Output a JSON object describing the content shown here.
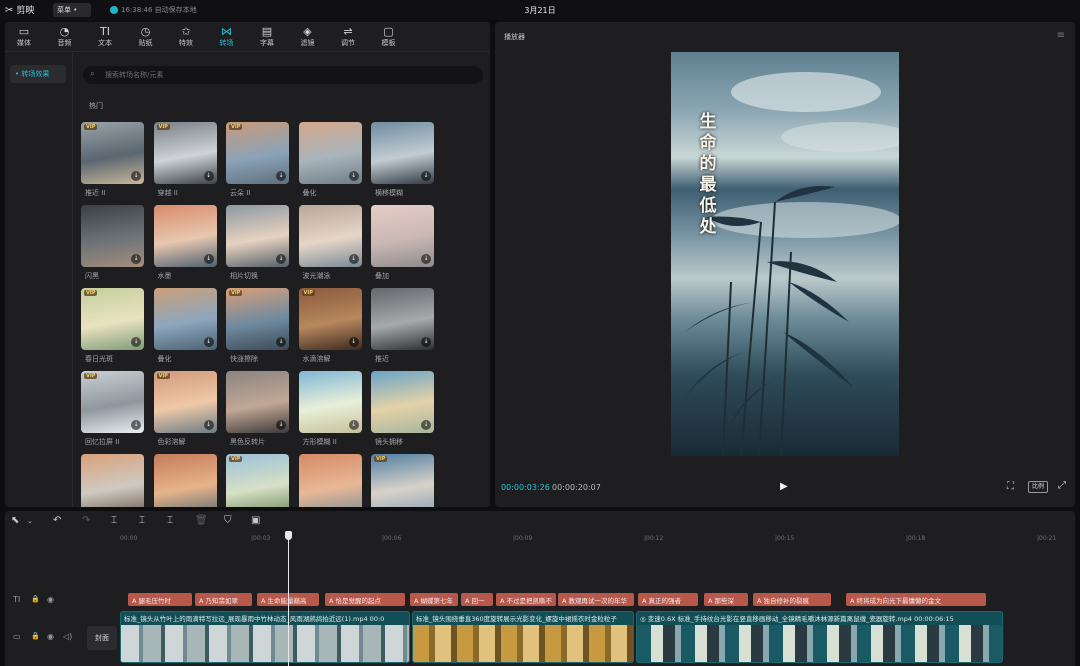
{
  "app": {
    "name": "剪映",
    "menu": "菜单 •",
    "save_status": "16:38:46 自动保存本地",
    "project_title": "3月21日"
  },
  "toolbar": [
    {
      "label": "媒体",
      "icon": "▭"
    },
    {
      "label": "音频",
      "icon": "◔"
    },
    {
      "label": "文本",
      "icon": "TI"
    },
    {
      "label": "贴纸",
      "icon": "◷"
    },
    {
      "label": "特效",
      "icon": "✩"
    },
    {
      "label": "转场",
      "icon": "⋈",
      "active": true
    },
    {
      "label": "字幕",
      "icon": "▤"
    },
    {
      "label": "滤镜",
      "icon": "◈"
    },
    {
      "label": "调节",
      "icon": "⇌"
    },
    {
      "label": "模板",
      "icon": "▢"
    }
  ],
  "side_nav": {
    "active_item": "• 转场效果"
  },
  "search": {
    "placeholder": "搜索转场名称/元素"
  },
  "section": {
    "title": "热门"
  },
  "transitions": [
    {
      "label": "推近 II",
      "vip": true
    },
    {
      "label": "穿越 II",
      "vip": true
    },
    {
      "label": "云朵 II",
      "vip": true
    },
    {
      "label": "叠化",
      "vip": false
    },
    {
      "label": "横移模糊",
      "vip": false
    },
    {
      "label": "闪黑",
      "vip": false
    },
    {
      "label": "水墨",
      "vip": false
    },
    {
      "label": "相片切换",
      "vip": false
    },
    {
      "label": "波光潮泳",
      "vip": false
    },
    {
      "label": "叠加",
      "vip": false
    },
    {
      "label": "春日光斑",
      "vip": true
    },
    {
      "label": "叠化",
      "vip": false
    },
    {
      "label": "快涨擦除",
      "vip": true
    },
    {
      "label": "水滴溶解",
      "vip": true
    },
    {
      "label": "推近",
      "vip": false
    },
    {
      "label": "回忆拉屏 II",
      "vip": true
    },
    {
      "label": "色彩溶解",
      "vip": true
    },
    {
      "label": "黑色反转片",
      "vip": false
    },
    {
      "label": "方形模糊 II",
      "vip": false
    },
    {
      "label": "镜头拥移",
      "vip": false
    },
    {
      "label": "",
      "vip": false
    },
    {
      "label": "",
      "vip": false
    },
    {
      "label": "",
      "vip": true
    },
    {
      "label": "",
      "vip": false
    },
    {
      "label": "",
      "vip": true
    }
  ],
  "player": {
    "title": "播放器",
    "caption": "生命的最低处",
    "time_current": "00:00:03:26",
    "time_total": "00:00:20:07",
    "ratio_label": "比例"
  },
  "timeline": {
    "ruler": [
      "00:00",
      "|00:03",
      "|00:06",
      "|00:09",
      "|00:12",
      "|00:15",
      "|00:18",
      "|00:21"
    ],
    "text_clips": [
      {
        "text": "A 腿毛压竹时"
      },
      {
        "text": "A 乃知翡如翠"
      },
      {
        "text": "A 生命能量巅高"
      },
      {
        "text": "A 恰是觉醒的起点"
      },
      {
        "text": "A 蝴蝶第七年"
      },
      {
        "text": "A 回一"
      },
      {
        "text": "A 不过是把凯嘶不"
      },
      {
        "text": "A 教观再试一次的年华"
      },
      {
        "text": "A 真正的强者"
      },
      {
        "text": "A 那些深"
      },
      {
        "text": "A 独自修补的裂痕"
      },
      {
        "text": "A 终将成为向光下最慵懒的金文"
      }
    ],
    "video_clips": [
      {
        "title": "标准_镜头从竹叶上的雨滴特写拉远_展现暴雨中竹林动态_风雨湖鹧鸪拍近远(1).mp4  00:0"
      },
      {
        "title": "标准_镜头围绕垂直360度旋转展示光影变化_螺旋中裙摇衣时金粒粒子"
      },
      {
        "title": "◎ 变速0.6X  标准_手持纹台光影在竖直移画移动_全镜精毛嚼沐林源新篇离鼠缠_瓷器旋转.mp4  00:00:06:15"
      }
    ],
    "cover_label": "封面"
  }
}
